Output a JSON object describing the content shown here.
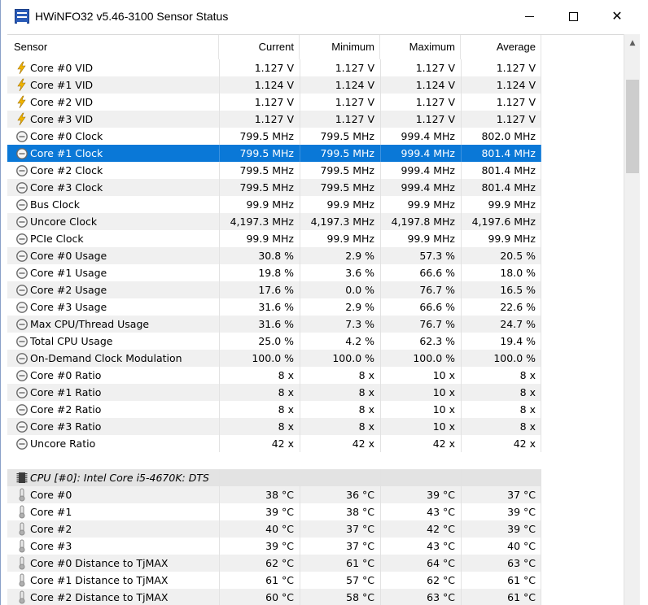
{
  "window": {
    "title": "HWiNFO32 v5.46-3100 Sensor Status",
    "close_glyph": "✕"
  },
  "columns": [
    "Sensor",
    "Current",
    "Minimum",
    "Maximum",
    "Average"
  ],
  "scrollbar": {
    "up_glyph": "▲"
  },
  "rows": [
    {
      "type": "voltage",
      "name": "Core #0 VID",
      "current": "1.127 V",
      "minimum": "1.127 V",
      "maximum": "1.127 V",
      "average": "1.127 V"
    },
    {
      "type": "voltage",
      "name": "Core #1 VID",
      "current": "1.124 V",
      "minimum": "1.124 V",
      "maximum": "1.124 V",
      "average": "1.124 V"
    },
    {
      "type": "voltage",
      "name": "Core #2 VID",
      "current": "1.127 V",
      "minimum": "1.127 V",
      "maximum": "1.127 V",
      "average": "1.127 V"
    },
    {
      "type": "voltage",
      "name": "Core #3 VID",
      "current": "1.127 V",
      "minimum": "1.127 V",
      "maximum": "1.127 V",
      "average": "1.127 V"
    },
    {
      "type": "clock",
      "name": "Core #0 Clock",
      "current": "799.5 MHz",
      "minimum": "799.5 MHz",
      "maximum": "999.4 MHz",
      "average": "802.0 MHz"
    },
    {
      "type": "clock",
      "name": "Core #1 Clock",
      "current": "799.5 MHz",
      "minimum": "799.5 MHz",
      "maximum": "999.4 MHz",
      "average": "801.4 MHz",
      "selected": true
    },
    {
      "type": "clock",
      "name": "Core #2 Clock",
      "current": "799.5 MHz",
      "minimum": "799.5 MHz",
      "maximum": "999.4 MHz",
      "average": "801.4 MHz"
    },
    {
      "type": "clock",
      "name": "Core #3 Clock",
      "current": "799.5 MHz",
      "minimum": "799.5 MHz",
      "maximum": "999.4 MHz",
      "average": "801.4 MHz"
    },
    {
      "type": "clock",
      "name": "Bus Clock",
      "current": "99.9 MHz",
      "minimum": "99.9 MHz",
      "maximum": "99.9 MHz",
      "average": "99.9 MHz"
    },
    {
      "type": "clock",
      "name": "Uncore Clock",
      "current": "4,197.3 MHz",
      "minimum": "4,197.3 MHz",
      "maximum": "4,197.8 MHz",
      "average": "4,197.6 MHz"
    },
    {
      "type": "clock",
      "name": "PCIe Clock",
      "current": "99.9 MHz",
      "minimum": "99.9 MHz",
      "maximum": "99.9 MHz",
      "average": "99.9 MHz"
    },
    {
      "type": "clock",
      "name": "Core #0 Usage",
      "current": "30.8 %",
      "minimum": "2.9 %",
      "maximum": "57.3 %",
      "average": "20.5 %"
    },
    {
      "type": "clock",
      "name": "Core #1 Usage",
      "current": "19.8 %",
      "minimum": "3.6 %",
      "maximum": "66.6 %",
      "average": "18.0 %"
    },
    {
      "type": "clock",
      "name": "Core #2 Usage",
      "current": "17.6 %",
      "minimum": "0.0 %",
      "maximum": "76.7 %",
      "average": "16.5 %"
    },
    {
      "type": "clock",
      "name": "Core #3 Usage",
      "current": "31.6 %",
      "minimum": "2.9 %",
      "maximum": "66.6 %",
      "average": "22.6 %"
    },
    {
      "type": "clock",
      "name": "Max CPU/Thread Usage",
      "current": "31.6 %",
      "minimum": "7.3 %",
      "maximum": "76.7 %",
      "average": "24.7 %"
    },
    {
      "type": "clock",
      "name": "Total CPU Usage",
      "current": "25.0 %",
      "minimum": "4.2 %",
      "maximum": "62.3 %",
      "average": "19.4 %"
    },
    {
      "type": "clock",
      "name": "On-Demand Clock Modulation",
      "current": "100.0 %",
      "minimum": "100.0 %",
      "maximum": "100.0 %",
      "average": "100.0 %"
    },
    {
      "type": "clock",
      "name": "Core #0 Ratio",
      "current": "8 x",
      "minimum": "8 x",
      "maximum": "10 x",
      "average": "8 x"
    },
    {
      "type": "clock",
      "name": "Core #1 Ratio",
      "current": "8 x",
      "minimum": "8 x",
      "maximum": "10 x",
      "average": "8 x"
    },
    {
      "type": "clock",
      "name": "Core #2 Ratio",
      "current": "8 x",
      "minimum": "8 x",
      "maximum": "10 x",
      "average": "8 x"
    },
    {
      "type": "clock",
      "name": "Core #3 Ratio",
      "current": "8 x",
      "minimum": "8 x",
      "maximum": "10 x",
      "average": "8 x"
    },
    {
      "type": "clock",
      "name": "Uncore Ratio",
      "current": "42 x",
      "minimum": "42 x",
      "maximum": "42 x",
      "average": "42 x"
    },
    {
      "type": "spacer"
    },
    {
      "type": "group",
      "name": "CPU [#0]: Intel Core i5-4670K: DTS"
    },
    {
      "type": "temp",
      "name": "Core #0",
      "current": "38 °C",
      "minimum": "36 °C",
      "maximum": "39 °C",
      "average": "37 °C"
    },
    {
      "type": "temp",
      "name": "Core #1",
      "current": "39 °C",
      "minimum": "38 °C",
      "maximum": "43 °C",
      "average": "39 °C"
    },
    {
      "type": "temp",
      "name": "Core #2",
      "current": "40 °C",
      "minimum": "37 °C",
      "maximum": "42 °C",
      "average": "39 °C"
    },
    {
      "type": "temp",
      "name": "Core #3",
      "current": "39 °C",
      "minimum": "37 °C",
      "maximum": "43 °C",
      "average": "40 °C"
    },
    {
      "type": "temp",
      "name": "Core #0 Distance to TjMAX",
      "current": "62 °C",
      "minimum": "61 °C",
      "maximum": "64 °C",
      "average": "63 °C"
    },
    {
      "type": "temp",
      "name": "Core #1 Distance to TjMAX",
      "current": "61 °C",
      "minimum": "57 °C",
      "maximum": "62 °C",
      "average": "61 °C"
    },
    {
      "type": "temp",
      "name": "Core #2 Distance to TjMAX",
      "current": "60 °C",
      "minimum": "58 °C",
      "maximum": "63 °C",
      "average": "61 °C"
    }
  ],
  "colors": {
    "selection": "#0a78d7",
    "alt_row": "#f0f0f0",
    "group_row": "#e3e3e3",
    "voltage_icon": "#f0b400",
    "clock_icon": "#6a6a6a",
    "temp_icon": "#8a8a8a"
  }
}
